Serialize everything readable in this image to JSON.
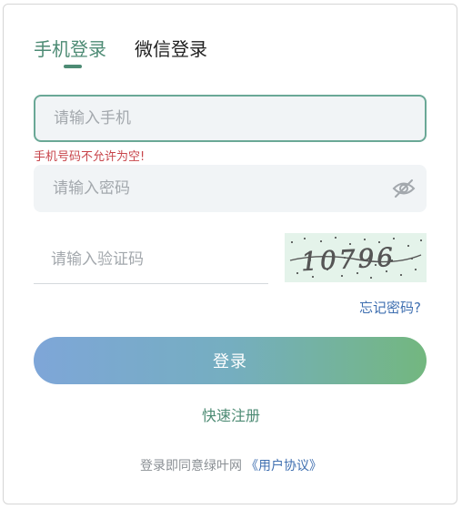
{
  "tabs": {
    "phone_login": "手机登录",
    "wechat_login": "微信登录"
  },
  "form": {
    "phone_placeholder": "请输入手机",
    "phone_error": "手机号码不允许为空!",
    "password_placeholder": "请输入密码",
    "code_placeholder": "请输入验证码",
    "captcha_text": "10796",
    "forgot_password": "忘记密码?",
    "login_button": "登录",
    "register_link": "快速注册"
  },
  "agreement": {
    "prefix": "登录即同意绿叶网",
    "link": "《用户协议》"
  },
  "colors": {
    "accent": "#4d8b74",
    "error": "#c7444a",
    "link": "#3f6fb0",
    "button_gradient_start": "#7ea6d8",
    "button_gradient_end": "#73b77f"
  },
  "icons": {
    "password_toggle": "eye-off-icon"
  }
}
